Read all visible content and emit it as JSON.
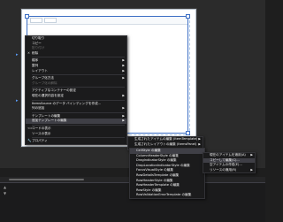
{
  "main_menu": {
    "items": [
      {
        "label": "切り取り",
        "disabled": false,
        "submenu": false,
        "icon": ""
      },
      {
        "label": "コピー",
        "disabled": false,
        "submenu": false,
        "icon": ""
      },
      {
        "label": "貼り付け",
        "disabled": true,
        "submenu": false,
        "icon": ""
      },
      {
        "label": "削除",
        "disabled": false,
        "submenu": false,
        "icon": "✕",
        "icon_name": "delete-icon",
        "sep_after": true
      },
      {
        "label": "順序",
        "disabled": false,
        "submenu": true,
        "icon": ""
      },
      {
        "label": "整列",
        "disabled": false,
        "submenu": true,
        "icon": ""
      },
      {
        "label": "レイアウト",
        "disabled": false,
        "submenu": true,
        "icon": "",
        "sep_after": true
      },
      {
        "label": "グループ化方法",
        "disabled": false,
        "submenu": true,
        "icon": ""
      },
      {
        "label": "グループ化の解除",
        "disabled": true,
        "submenu": false,
        "icon": "",
        "sep_after": true
      },
      {
        "label": "アクティブなコンテナーの設定",
        "disabled": false,
        "submenu": false,
        "icon": ""
      },
      {
        "label": "現在の選択内容を設定",
        "disabled": false,
        "submenu": true,
        "icon": "",
        "sep_after": true
      },
      {
        "label": "ItemsSource のデータ バインディングを作成...",
        "disabled": false,
        "submenu": false,
        "icon": ""
      },
      {
        "label": "列の追加",
        "disabled": false,
        "submenu": true,
        "icon": "",
        "sep_after": true
      },
      {
        "label": "テンプレートの編集",
        "disabled": false,
        "submenu": true,
        "icon": ""
      },
      {
        "label": "追加テンプレートの編集",
        "disabled": false,
        "submenu": true,
        "icon": "",
        "highlighted": true,
        "sep_after": true
      },
      {
        "label": "コードの表示",
        "disabled": false,
        "submenu": false,
        "icon": "<>",
        "icon_name": "code-icon"
      },
      {
        "label": "ソースの表示",
        "disabled": false,
        "submenu": false,
        "icon": "",
        "sep_after": true
      },
      {
        "label": "プロパティ",
        "disabled": false,
        "submenu": false,
        "icon": "🔧",
        "icon_name": "wrench-icon"
      }
    ]
  },
  "templates_menu": {
    "items": [
      {
        "label": "生成されたアイテムの編集 (ItemTemplate)",
        "submenu": true
      },
      {
        "label": "生成されたレイアウトの編集 (ItemsPanel)",
        "submenu": true,
        "sep_after": true
      }
    ]
  },
  "styles_menu": {
    "items": [
      {
        "label": "CellStyle の編集",
        "highlighted": true
      },
      {
        "label": "ColumnHeaderStyle の編集"
      },
      {
        "label": "DragIndicatorStyle の編集"
      },
      {
        "label": "DropLocationIndicatorStyle の編集"
      },
      {
        "label": "FocusVisualStyle の編集"
      },
      {
        "label": "RowDetailsTemplate の編集"
      },
      {
        "label": "RowHeaderStyle の編集"
      },
      {
        "label": "RowHeaderTemplate の編集"
      },
      {
        "label": "RowStyle の編集"
      },
      {
        "label": "RowValidationErrorTemplate の編集"
      }
    ]
  },
  "resource_menu": {
    "items": [
      {
        "label": "現在のアイテムを適用(A)",
        "submenu": true
      },
      {
        "label": "コピーして編集(C)...",
        "submenu": false,
        "highlighted": true
      },
      {
        "label": "空アイテムの作成(E)...",
        "submenu": false
      },
      {
        "label": "リソースの適用(R)",
        "submenu": true
      }
    ]
  },
  "colors": {
    "menu_bg": "#1b1b1c",
    "menu_highlight": "#3f3f46",
    "selection": "#3c6ec4",
    "disabled_text": "#6d6d6d"
  }
}
